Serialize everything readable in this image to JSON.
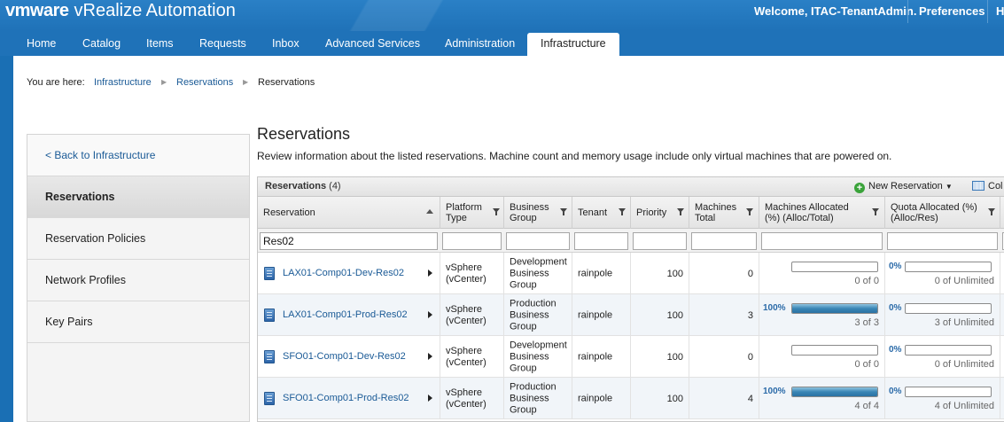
{
  "app": {
    "logo_brand": "vmware",
    "logo_product": "vRealize Automation",
    "welcome": "Welcome, ITAC-TenantAdmin.",
    "preferences": "Preferences",
    "help": "H"
  },
  "nav": {
    "items": [
      "Home",
      "Catalog",
      "Items",
      "Requests",
      "Inbox",
      "Advanced Services",
      "Administration",
      "Infrastructure"
    ],
    "active": "Infrastructure"
  },
  "breadcrumb": {
    "prefix": "You are here:",
    "items": [
      "Infrastructure",
      "Reservations",
      "Reservations"
    ]
  },
  "sidebar": {
    "back": "< Back to Infrastructure",
    "items": [
      "Reservations",
      "Reservation Policies",
      "Network Profiles",
      "Key Pairs"
    ],
    "active": "Reservations"
  },
  "page": {
    "title": "Reservations",
    "description": "Review information about the listed reservations. Machine count and memory usage include only virtual machines that are powered on."
  },
  "grid": {
    "title": "Reservations",
    "count": "(4)",
    "new_button": "New Reservation",
    "columns_button": "Col",
    "headers": {
      "reservation": "Reservation",
      "platform": "Platform\nType",
      "business_group": "Business\nGroup",
      "tenant": "Tenant",
      "priority": "Priority",
      "machines_total": "Machines\nTotal",
      "machines_allocated": "Machines Allocated\n(%) (Alloc/Total)",
      "quota_allocated": "Quota Allocated (%)\n(Alloc/Res)"
    },
    "filter_value": "Res02",
    "rows": [
      {
        "name": "LAX01-Comp01-Dev-Res02",
        "platform": "vSphere\n(vCenter)",
        "group": "Development\nBusiness\nGroup",
        "tenant": "rainpole",
        "priority": "100",
        "total": "0",
        "alloc_pct": "",
        "alloc_fill": 0,
        "alloc_text": "0 of 0",
        "quota_pct": "0%",
        "quota_fill": 0,
        "quota_text": "0 of Unlimited"
      },
      {
        "name": "LAX01-Comp01-Prod-Res02",
        "platform": "vSphere\n(vCenter)",
        "group": "Production\nBusiness\nGroup",
        "tenant": "rainpole",
        "priority": "100",
        "total": "3",
        "alloc_pct": "100%",
        "alloc_fill": 1,
        "alloc_text": "3 of 3",
        "quota_pct": "0%",
        "quota_fill": 0,
        "quota_text": "3 of Unlimited"
      },
      {
        "name": "SFO01-Comp01-Dev-Res02",
        "platform": "vSphere\n(vCenter)",
        "group": "Development\nBusiness\nGroup",
        "tenant": "rainpole",
        "priority": "100",
        "total": "0",
        "alloc_pct": "",
        "alloc_fill": 0,
        "alloc_text": "0 of 0",
        "quota_pct": "0%",
        "quota_fill": 0,
        "quota_text": "0 of Unlimited"
      },
      {
        "name": "SFO01-Comp01-Prod-Res02",
        "platform": "vSphere\n(vCenter)",
        "group": "Production\nBusiness\nGroup",
        "tenant": "rainpole",
        "priority": "100",
        "total": "4",
        "alloc_pct": "100%",
        "alloc_fill": 1,
        "alloc_text": "4 of 4",
        "quota_pct": "0%",
        "quota_fill": 0,
        "quota_text": "4 of Unlimited"
      }
    ]
  }
}
